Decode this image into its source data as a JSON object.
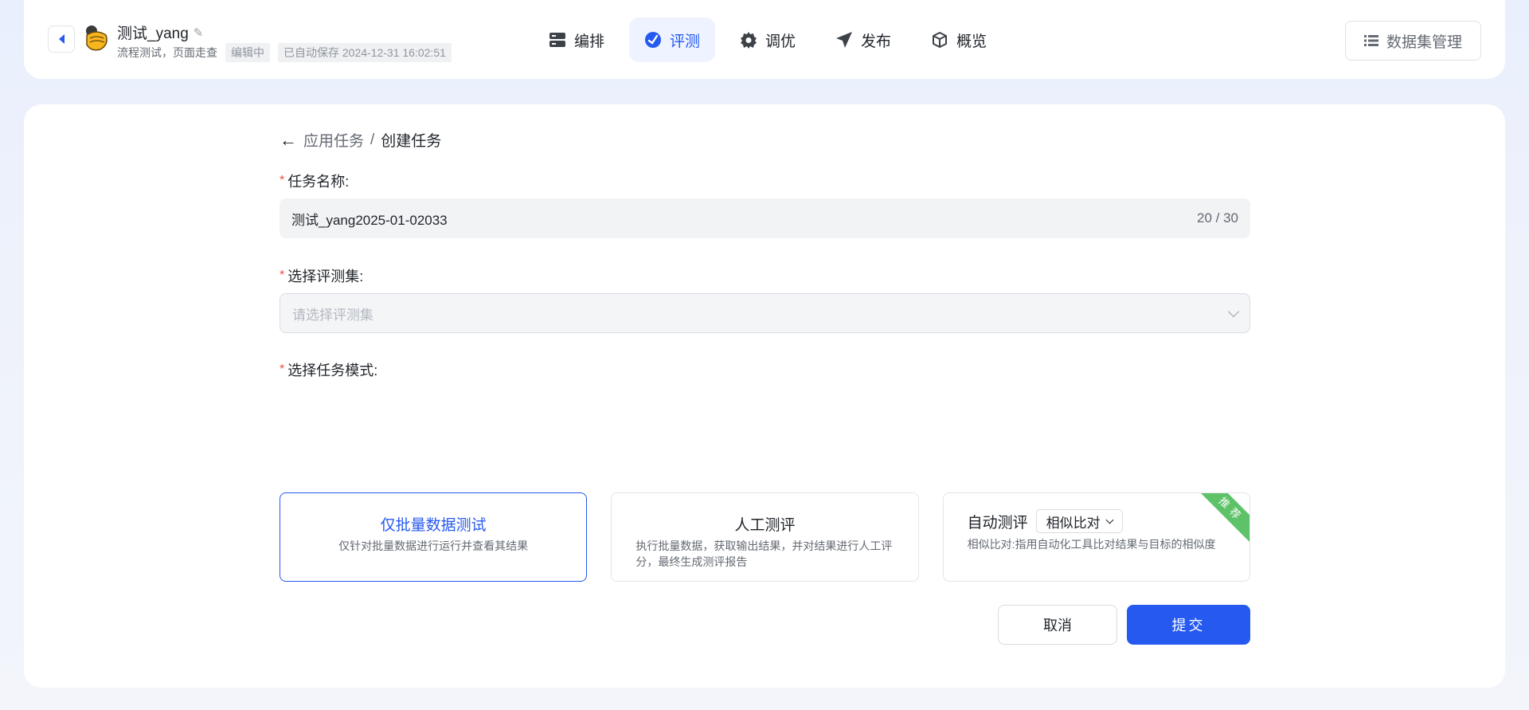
{
  "header": {
    "app_name": "测试_yang",
    "app_desc": "流程测试，页面走查",
    "status_chip": "编辑中",
    "autosave_chip": "已自动保存 2024-12-31 16:02:51",
    "nav": [
      {
        "label": "编排",
        "icon": "server-icon",
        "active": false
      },
      {
        "label": "评测",
        "icon": "gauge-icon",
        "active": true
      },
      {
        "label": "调优",
        "icon": "gear-icon",
        "active": false
      },
      {
        "label": "发布",
        "icon": "send-icon",
        "active": false
      },
      {
        "label": "概览",
        "icon": "cube-icon",
        "active": false
      }
    ],
    "dataset_button": "数据集管理"
  },
  "breadcrumb": {
    "parent": "应用任务",
    "separator": "/",
    "current": "创建任务"
  },
  "form": {
    "task_name": {
      "label": "任务名称:",
      "value": "测试_yang2025-01-02033",
      "count": "20 / 30"
    },
    "eval_set": {
      "label": "选择评测集:",
      "placeholder": "请选择评测集"
    },
    "task_mode": {
      "label": "选择任务模式:",
      "options": [
        {
          "title": "仅批量数据测试",
          "desc": "仅针对批量数据进行运行并查看其结果",
          "selected": true
        },
        {
          "title": "人工测评",
          "desc": "执行批量数据，获取输出结果，并对结果进行人工评分，最终生成测评报告",
          "selected": false
        },
        {
          "title": "自动测评",
          "select_value": "相似比对",
          "desc": "相似比对:指用自动化工具比对结果与目标的相似度",
          "badge": "推荐",
          "selected": false
        }
      ]
    }
  },
  "actions": {
    "cancel": "取消",
    "submit": "提交"
  },
  "colors": {
    "accent": "#2559f0",
    "badge": "#5ec269",
    "required": "#f54a45"
  }
}
